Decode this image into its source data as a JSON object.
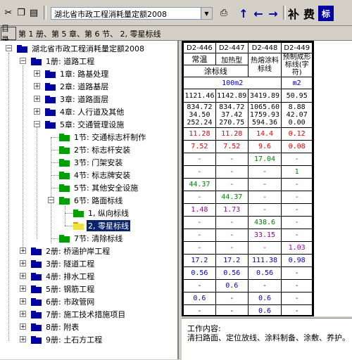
{
  "toolbar": {
    "combo_value": "湖北省市政工程消耗量定额2008",
    "buttons": [
      "scissors-icon",
      "copy-icon",
      "paste-icon",
      "print-icon",
      "folder-open-icon"
    ],
    "nav": {
      "up": "↑",
      "left": "←",
      "right": "→"
    },
    "supplement_label": "补",
    "fee_label": "费",
    "flag_label": "标"
  },
  "crumbbar": {
    "dir_label": "目录",
    "path": "第 1 册、第 5 章、第 6 节、 2, 零星标线"
  },
  "tree": {
    "root": "湖北省市政工程消耗量定额2008",
    "items": [
      {
        "label": "1册: 道路工程"
      },
      {
        "label": "1章: 路基处理"
      },
      {
        "label": "2章: 道路基层"
      },
      {
        "label": "3章: 道路面层"
      },
      {
        "label": "4章: 人行道及其他"
      },
      {
        "label": "5章: 交通管理设施"
      },
      {
        "label": "1节: 交通标志杆制作"
      },
      {
        "label": "2节: 标志杆安装"
      },
      {
        "label": "3节: 门架安装"
      },
      {
        "label": "4节: 标志牌安装"
      },
      {
        "label": "5节: 其他安全设施"
      },
      {
        "label": "6节: 路面标线"
      },
      {
        "label": "1, 纵向标线"
      },
      {
        "label": "2, 零星标线"
      },
      {
        "label": "7节: 清除标线"
      },
      {
        "label": "2册: 桥涵护岸工程"
      },
      {
        "label": "3册: 隧道工程"
      },
      {
        "label": "4册: 排水工程"
      },
      {
        "label": "5册: 钢筋工程"
      },
      {
        "label": "6册: 市政管网"
      },
      {
        "label": "7册: 施工技术措施项目"
      },
      {
        "label": "8册: 附表"
      },
      {
        "label": "9册: 土石方工程"
      }
    ]
  },
  "grid": {
    "codes": [
      "D2-446",
      "D2-447",
      "D2-448",
      "D2-449"
    ],
    "names": [
      "常温",
      "加热型",
      "热熔涂料标线",
      "预制成形标线(字符)"
    ],
    "group_name": "涂标线",
    "units": [
      "100m2",
      "m2"
    ],
    "base_prices": [
      "1121.46",
      "1142.89",
      "3419.89",
      "50.95"
    ],
    "components": [
      [
        "834.72",
        "34.50",
        "252.24"
      ],
      [
        "834.72",
        "37.42",
        "270.75"
      ],
      [
        "1065.60",
        "1759.93",
        "594.36"
      ],
      [
        "8.88",
        "42.07",
        "0.00"
      ]
    ],
    "rows": [
      {
        "color": "red",
        "vals": [
          "11.28",
          "11.28",
          "14.4",
          "0.12"
        ]
      },
      {
        "color": "red",
        "vals": [
          "7.52",
          "7.52",
          "9.6",
          "0.08"
        ]
      },
      {
        "color": "green",
        "vals": [
          "-",
          "-",
          "17.04",
          "-"
        ]
      },
      {
        "color": "green",
        "vals": [
          "-",
          "-",
          "-",
          "1"
        ]
      },
      {
        "color": "green",
        "vals": [
          "44.37",
          "-",
          "-",
          "-"
        ]
      },
      {
        "color": "green",
        "vals": [
          "-",
          "44.37",
          "-",
          "-"
        ]
      },
      {
        "color": "purple",
        "vals": [
          "1.48",
          "1.73",
          "-",
          "-"
        ]
      },
      {
        "color": "green",
        "vals": [
          "-",
          "-",
          "438.6",
          "-"
        ]
      },
      {
        "color": "purple",
        "vals": [
          "-",
          "-",
          "33.15",
          "-"
        ]
      },
      {
        "color": "purple",
        "vals": [
          "-",
          "-",
          "-",
          "1.03"
        ]
      },
      {
        "color": "blue",
        "vals": [
          "17.2",
          "17.2",
          "111.38",
          "0.98"
        ]
      },
      {
        "color": "blue",
        "vals": [
          "0.56",
          "0.56",
          "0.56",
          "-"
        ]
      },
      {
        "color": "blue",
        "vals": [
          "-",
          "0.6",
          "-",
          "-"
        ]
      },
      {
        "color": "blue",
        "vals": [
          "0.6",
          "-",
          "0.6",
          "-"
        ]
      },
      {
        "color": "blue",
        "vals": [
          "-",
          "-",
          "0.6",
          "-"
        ]
      }
    ]
  },
  "work": {
    "title": "工作内容:",
    "content": "清扫路面、定位放线、涂料制备、涂敷、养护。"
  }
}
